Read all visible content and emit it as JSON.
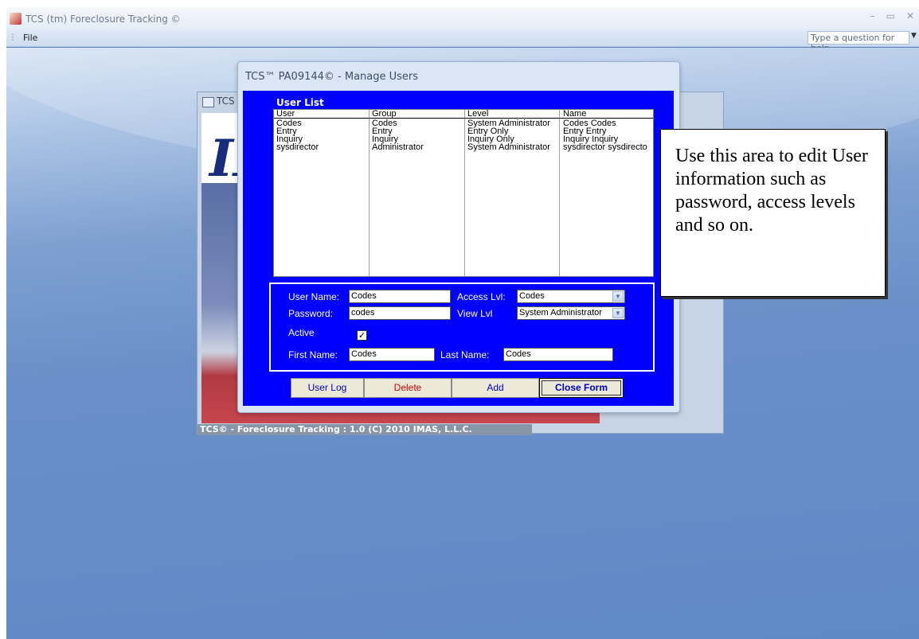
{
  "app": {
    "title": "TCS (tm) Foreclosure Tracking ©",
    "window_controls": {
      "minimize": "–",
      "restore": "▭",
      "close": "✕"
    }
  },
  "menubar": {
    "file_label": "File",
    "help_placeholder": "Type a question for help"
  },
  "background_window": {
    "title": "TCS",
    "logo_text": "IM",
    "footer": "TCS© - Foreclosure Tracking : 1.0  (C) 2010 IMAS, L.L.C."
  },
  "dialog": {
    "title": "TCS™ PA09144© - Manage Users",
    "user_list_label": "User List",
    "columns": [
      "User",
      "Group",
      "Level",
      "Name"
    ],
    "rows": [
      [
        "Codes",
        "Codes",
        "System Administrator",
        "Codes Codes"
      ],
      [
        "Entry",
        "Entry",
        "Entry Only",
        "Entry Entry"
      ],
      [
        "Inquiry",
        "Inquiry",
        "Inquiry Only",
        "Inquiry Inquiry"
      ],
      [
        "sysdirector",
        "Administrator",
        "System Administrator",
        "sysdirector sysdirecto"
      ]
    ],
    "form": {
      "user_name_label": "User Name:",
      "user_name_value": "Codes",
      "password_label": "Password:",
      "password_value": "codes",
      "access_lvl_label": "Access Lvl:",
      "access_lvl_value": "Codes",
      "view_lvl_label": "View Lvl",
      "view_lvl_value": "System Administrator",
      "active_label": "Active",
      "active_checked": true,
      "first_name_label": "First Name:",
      "first_name_value": "Codes",
      "last_name_label": "Last Name:",
      "last_name_value": "Codes"
    },
    "buttons": {
      "user_log": "User Log",
      "delete": "Delete",
      "add": "Add",
      "close_form": "Close Form"
    }
  },
  "callout": {
    "text": "Use this area to edit User information such as password, access levels and so on."
  },
  "colors": {
    "dialog_body": "#0000ff",
    "delete_text": "#d40000",
    "button_text": "#0000cc"
  }
}
